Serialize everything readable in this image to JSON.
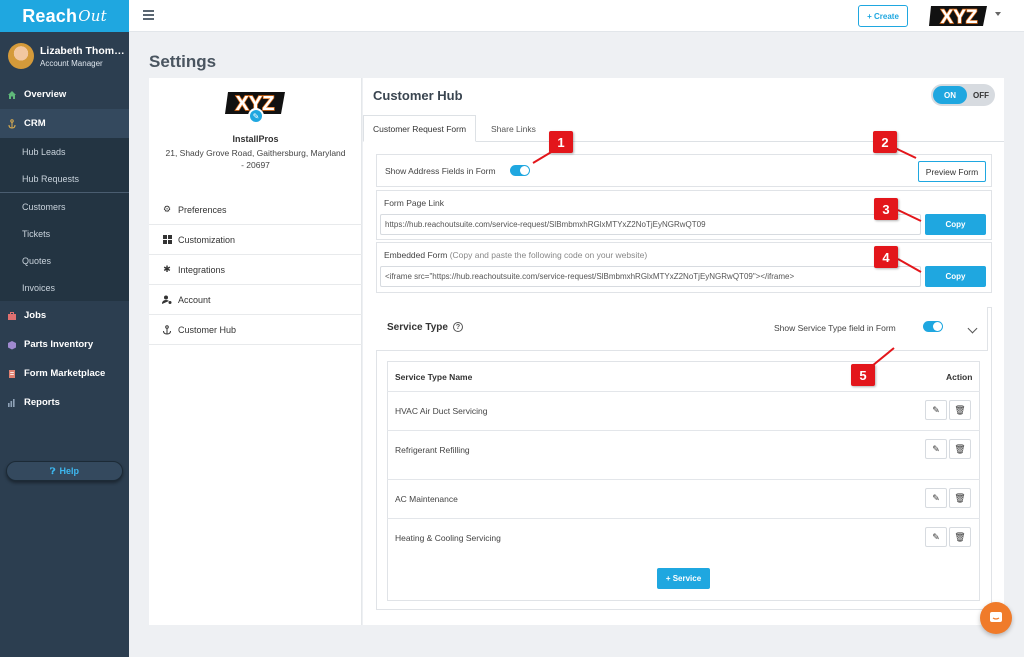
{
  "brand": {
    "name": "Reach",
    "suffix": "Out"
  },
  "user": {
    "name": "Lizabeth Thom…",
    "role": "Account Manager"
  },
  "sidebar": {
    "items": [
      {
        "label": "Overview",
        "icon": "home-icon"
      },
      {
        "label": "CRM",
        "icon": "anchor-icon"
      }
    ],
    "crm_sub": [
      "Hub Leads",
      "Hub Requests"
    ],
    "crm_sub2": [
      "Customers",
      "Tickets",
      "Quotes",
      "Invoices"
    ],
    "items2": [
      {
        "label": "Jobs",
        "icon": "briefcase-icon"
      },
      {
        "label": "Parts Inventory",
        "icon": "box-icon"
      },
      {
        "label": "Form Marketplace",
        "icon": "document-icon"
      },
      {
        "label": "Reports",
        "icon": "bar-chart-icon"
      }
    ],
    "help": "Help"
  },
  "topbar": {
    "create_label": "+ Create",
    "logo_text": "XYZ"
  },
  "page": {
    "title": "Settings"
  },
  "company": {
    "logo_text": "XYZ",
    "name": "InstallPros",
    "address": "21, Shady Grove Road, Gaithersburg, Maryland - 20697"
  },
  "settings_menu": [
    {
      "label": "Preferences",
      "icon": "gear-icon"
    },
    {
      "label": "Customization",
      "icon": "grid-icon"
    },
    {
      "label": "Integrations",
      "icon": "puzzle-icon"
    },
    {
      "label": "Account",
      "icon": "user-gear-icon"
    },
    {
      "label": "Customer Hub",
      "icon": "hub-icon"
    }
  ],
  "hub": {
    "title": "Customer Hub",
    "toggle_on": "ON",
    "toggle_off": "OFF",
    "tabs": [
      "Customer Request Form",
      "Share Links"
    ],
    "show_address_label": "Show Address Fields in Form",
    "preview_label": "Preview Form",
    "form_link_label": "Form Page Link",
    "form_link_value": "https://hub.reachoutsuite.com/service-request/SlBmbmxhRGlxMTYxZ2NoTjEyNGRwQT09",
    "copy_label": "Copy",
    "embedded_label": "Embedded Form",
    "embedded_hint": "(Copy and paste the following code on your website)",
    "embedded_value": "<iframe src=\"https://hub.reachoutsuite.com/service-request/SlBmbmxhRGlxMTYxZ2NoTjEyNGRwQT09\"></iframe>"
  },
  "service_type": {
    "title": "Service Type",
    "show_field_label": "Show Service Type field in Form",
    "col_name": "Service Type Name",
    "col_action": "Action",
    "rows": [
      "HVAC Air Duct Servicing",
      "Refrigerant Refilling",
      "AC Maintenance",
      "Heating & Cooling Servicing"
    ],
    "add_label": "+ Service"
  },
  "callouts": [
    "1",
    "2",
    "3",
    "4",
    "5"
  ],
  "colors": {
    "accent": "#1fa7e0",
    "sidebar": "#2c3e50",
    "callout": "#e3161b",
    "chat": "#f07b2a"
  }
}
